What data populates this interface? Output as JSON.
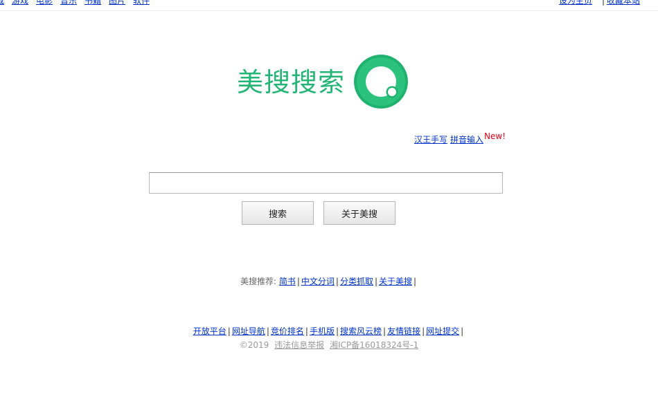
{
  "top_nav": {
    "links": [
      "载",
      "游戏",
      "电影",
      "音乐",
      "书籍",
      "图片",
      "软件"
    ],
    "right_links": [
      "设为主页",
      "收藏本站"
    ],
    "separator": "|"
  },
  "logo": {
    "text": "美搜搜索",
    "icon": "green-ring-magnifier-logo",
    "color": "#22b573"
  },
  "ime": {
    "handwriting": "汉王手写",
    "pinyin": "拼音输入",
    "new_badge": "New!",
    "badge_color": "#e60012"
  },
  "search": {
    "value": "",
    "placeholder": ""
  },
  "buttons": {
    "search": "搜索",
    "about": "关于美搜"
  },
  "recommend": {
    "label": "美搜推荐:",
    "links": [
      "简书",
      "中文分词",
      "分类抓取",
      "关于美搜"
    ],
    "separator": "|"
  },
  "footer": {
    "links": [
      "开放平台",
      "网址导航",
      "竞价排名",
      "手机版",
      "搜索风云榜",
      "友情链接",
      "网址提交"
    ],
    "separator": "|"
  },
  "copyright": {
    "year": "©2019",
    "report": "违法信息举报",
    "icp": "湘ICP备16018324号-1"
  },
  "colors": {
    "link": "#0033cc",
    "brand_green": "#22b573"
  }
}
